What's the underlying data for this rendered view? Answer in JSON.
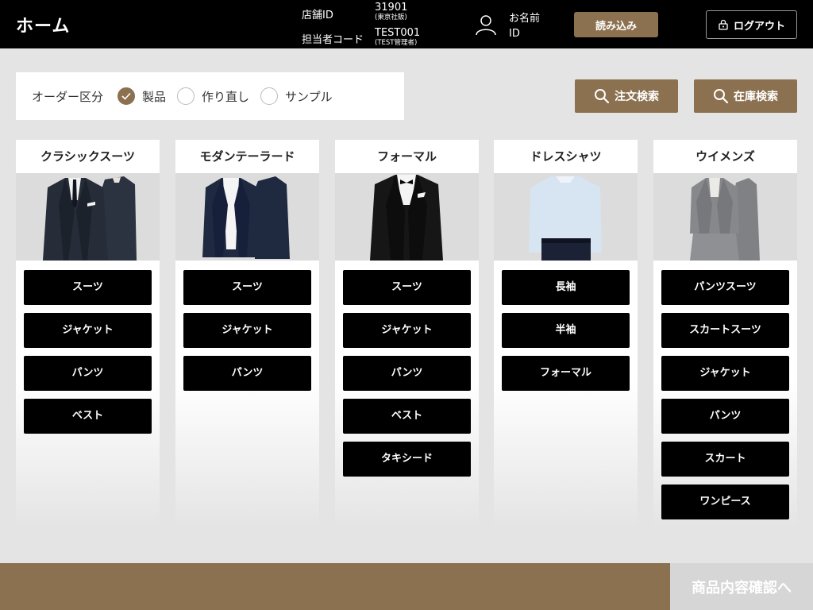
{
  "header": {
    "title": "ホーム",
    "store_id_label": "店舗ID",
    "store_id_value": "31901",
    "store_name": "(東京社販)",
    "staff_code_label": "担当者コード",
    "staff_code_value": "TEST001",
    "staff_name": "(TEST管理者)",
    "user_name_label": "お名前",
    "user_id_label": "ID",
    "load_button": "読み込み",
    "logout_button": "ログアウト",
    "icons": {
      "user": "user-icon",
      "logout": "lock-icon"
    }
  },
  "order_type": {
    "label": "オーダー区分",
    "options": [
      {
        "label": "製品",
        "checked": true
      },
      {
        "label": "作り直し",
        "checked": false
      },
      {
        "label": "サンプル",
        "checked": false
      }
    ]
  },
  "search": {
    "order_search": "注文検索",
    "stock_search": "在庫検索",
    "icon": "search-icon"
  },
  "categories": [
    {
      "title": "クラシックスーツ",
      "items": [
        "スーツ",
        "ジャケット",
        "パンツ",
        "ベスト"
      ]
    },
    {
      "title": "モダンテーラード",
      "items": [
        "スーツ",
        "ジャケット",
        "パンツ"
      ]
    },
    {
      "title": "フォーマル",
      "items": [
        "スーツ",
        "ジャケット",
        "パンツ",
        "ベスト",
        "タキシード"
      ]
    },
    {
      "title": "ドレスシャツ",
      "items": [
        "長袖",
        "半袖",
        "フォーマル"
      ]
    },
    {
      "title": "ウイメンズ",
      "items": [
        "パンツスーツ",
        "スカートスーツ",
        "ジャケット",
        "パンツ",
        "スカート",
        "ワンピース"
      ]
    }
  ],
  "footer": {
    "confirm_button": "商品内容確認へ"
  },
  "colors": {
    "accent": "#8c7150",
    "header_bg": "#000000",
    "page_bg": "#e4e4e4",
    "disabled": "#d6d6d6"
  }
}
